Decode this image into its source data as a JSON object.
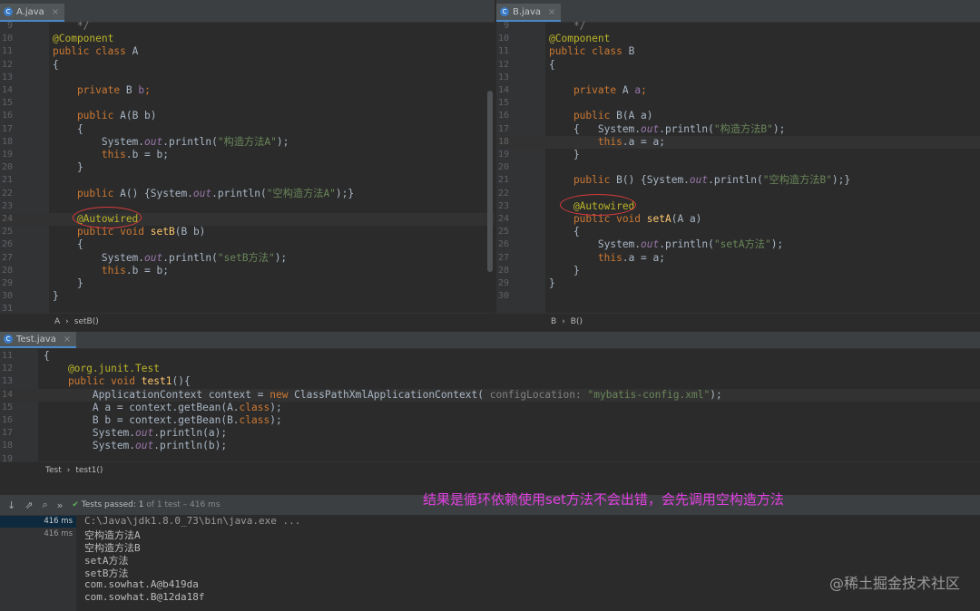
{
  "tabs": {
    "a": "A.java",
    "b": "B.java",
    "test": "Test.java"
  },
  "editor_a": {
    "lines": [
      {
        "n": "9",
        "tokens": [
          {
            "t": "    */",
            "c": "cm"
          }
        ]
      },
      {
        "n": "10",
        "tokens": [
          {
            "t": "@Component",
            "c": "an"
          }
        ]
      },
      {
        "n": "11",
        "tokens": [
          {
            "t": "public class ",
            "c": "kw"
          },
          {
            "t": "A",
            "c": ""
          }
        ]
      },
      {
        "n": "12",
        "tokens": [
          {
            "t": "{",
            "c": ""
          }
        ]
      },
      {
        "n": "13",
        "tokens": []
      },
      {
        "n": "14",
        "tokens": [
          {
            "t": "    private ",
            "c": "kw"
          },
          {
            "t": "B ",
            "c": ""
          },
          {
            "t": "b",
            "c": "hl"
          },
          {
            "t": ";",
            "c": "kw"
          }
        ]
      },
      {
        "n": "15",
        "tokens": []
      },
      {
        "n": "16",
        "tokens": [
          {
            "t": "    public ",
            "c": "kw"
          },
          {
            "t": "A(B b)",
            "c": ""
          }
        ]
      },
      {
        "n": "17",
        "tokens": [
          {
            "t": "    {",
            "c": ""
          }
        ]
      },
      {
        "n": "18",
        "tokens": [
          {
            "t": "        System.",
            "c": ""
          },
          {
            "t": "out",
            "c": "fd"
          },
          {
            "t": ".println(",
            "c": ""
          },
          {
            "t": "\"构造方法A\"",
            "c": "st"
          },
          {
            "t": ");",
            "c": ""
          }
        ]
      },
      {
        "n": "19",
        "tokens": [
          {
            "t": "        this",
            "c": "kw"
          },
          {
            "t": ".b = b;",
            "c": ""
          }
        ]
      },
      {
        "n": "20",
        "tokens": [
          {
            "t": "    }",
            "c": ""
          }
        ]
      },
      {
        "n": "21",
        "tokens": []
      },
      {
        "n": "22",
        "tokens": [
          {
            "t": "    public ",
            "c": "kw"
          },
          {
            "t": "A() {System.",
            "c": ""
          },
          {
            "t": "out",
            "c": "fd"
          },
          {
            "t": ".println(",
            "c": ""
          },
          {
            "t": "\"空构造方法A\"",
            "c": "st"
          },
          {
            "t": ");}",
            "c": ""
          }
        ]
      },
      {
        "n": "23",
        "tokens": []
      },
      {
        "n": "24",
        "tokens": [
          {
            "t": "    @Autowired",
            "c": "an"
          }
        ]
      },
      {
        "n": "25",
        "tokens": [
          {
            "t": "    public void ",
            "c": "kw"
          },
          {
            "t": "setB",
            "c": "fn"
          },
          {
            "t": "(B b)",
            "c": ""
          }
        ]
      },
      {
        "n": "26",
        "tokens": [
          {
            "t": "    {",
            "c": ""
          }
        ]
      },
      {
        "n": "27",
        "tokens": [
          {
            "t": "        System.",
            "c": ""
          },
          {
            "t": "out",
            "c": "fd"
          },
          {
            "t": ".println(",
            "c": ""
          },
          {
            "t": "\"setB方法\"",
            "c": "st"
          },
          {
            "t": ");",
            "c": ""
          }
        ]
      },
      {
        "n": "28",
        "tokens": [
          {
            "t": "        this",
            "c": "kw"
          },
          {
            "t": ".b = b;",
            "c": ""
          }
        ]
      },
      {
        "n": "29",
        "tokens": [
          {
            "t": "    }",
            "c": ""
          }
        ]
      },
      {
        "n": "30",
        "tokens": [
          {
            "t": "}",
            "c": ""
          }
        ]
      },
      {
        "n": "31",
        "tokens": []
      }
    ],
    "breadcrumb": [
      "A",
      "setB()"
    ]
  },
  "editor_b": {
    "lines": [
      {
        "n": "9",
        "tokens": [
          {
            "t": "    */",
            "c": "cm"
          }
        ]
      },
      {
        "n": "10",
        "tokens": [
          {
            "t": "@Component",
            "c": "an"
          }
        ]
      },
      {
        "n": "11",
        "tokens": [
          {
            "t": "public class ",
            "c": "kw"
          },
          {
            "t": "B",
            "c": ""
          }
        ]
      },
      {
        "n": "12",
        "tokens": [
          {
            "t": "{",
            "c": ""
          }
        ]
      },
      {
        "n": "13",
        "tokens": []
      },
      {
        "n": "14",
        "tokens": [
          {
            "t": "    private ",
            "c": "kw"
          },
          {
            "t": "A ",
            "c": ""
          },
          {
            "t": "a",
            "c": "hl"
          },
          {
            "t": ";",
            "c": "kw"
          }
        ]
      },
      {
        "n": "15",
        "tokens": []
      },
      {
        "n": "16",
        "tokens": [
          {
            "t": "    public ",
            "c": "kw"
          },
          {
            "t": "B(A a)",
            "c": ""
          }
        ]
      },
      {
        "n": "17",
        "tokens": [
          {
            "t": "    {   System.",
            "c": ""
          },
          {
            "t": "out",
            "c": "fd"
          },
          {
            "t": ".println(",
            "c": ""
          },
          {
            "t": "\"构造方法B\"",
            "c": "st"
          },
          {
            "t": ");",
            "c": ""
          }
        ]
      },
      {
        "n": "18",
        "tokens": [
          {
            "t": "        this",
            "c": "kw"
          },
          {
            "t": ".a = a;",
            "c": ""
          }
        ]
      },
      {
        "n": "19",
        "tokens": [
          {
            "t": "    }",
            "c": ""
          }
        ]
      },
      {
        "n": "20",
        "tokens": []
      },
      {
        "n": "21",
        "tokens": [
          {
            "t": "    public ",
            "c": "kw"
          },
          {
            "t": "B() {System.",
            "c": ""
          },
          {
            "t": "out",
            "c": "fd"
          },
          {
            "t": ".println(",
            "c": ""
          },
          {
            "t": "\"空构造方法B\"",
            "c": "st"
          },
          {
            "t": ");}",
            "c": ""
          }
        ]
      },
      {
        "n": "22",
        "tokens": []
      },
      {
        "n": "23",
        "tokens": [
          {
            "t": "    @Autowired",
            "c": "an"
          }
        ]
      },
      {
        "n": "24",
        "tokens": [
          {
            "t": "    public void ",
            "c": "kw"
          },
          {
            "t": "setA",
            "c": "fn"
          },
          {
            "t": "(A a)",
            "c": ""
          }
        ]
      },
      {
        "n": "25",
        "tokens": [
          {
            "t": "    {",
            "c": ""
          }
        ]
      },
      {
        "n": "26",
        "tokens": [
          {
            "t": "        System.",
            "c": ""
          },
          {
            "t": "out",
            "c": "fd"
          },
          {
            "t": ".println(",
            "c": ""
          },
          {
            "t": "\"setA方法\"",
            "c": "st"
          },
          {
            "t": ");",
            "c": ""
          }
        ]
      },
      {
        "n": "27",
        "tokens": [
          {
            "t": "        this",
            "c": "kw"
          },
          {
            "t": ".a = a;",
            "c": ""
          }
        ]
      },
      {
        "n": "28",
        "tokens": [
          {
            "t": "    }",
            "c": ""
          }
        ]
      },
      {
        "n": "29",
        "tokens": [
          {
            "t": "}",
            "c": ""
          }
        ]
      },
      {
        "n": "30",
        "tokens": []
      }
    ],
    "breadcrumb": [
      "B",
      "B()"
    ]
  },
  "editor_test": {
    "lines": [
      {
        "n": "11",
        "tokens": [
          {
            "t": "{",
            "c": ""
          }
        ]
      },
      {
        "n": "12",
        "tokens": [
          {
            "t": "    @org.junit.Test",
            "c": "an"
          }
        ]
      },
      {
        "n": "13",
        "tokens": [
          {
            "t": "    public void ",
            "c": "kw"
          },
          {
            "t": "test1",
            "c": "fn"
          },
          {
            "t": "(){",
            "c": ""
          }
        ]
      },
      {
        "n": "14",
        "tokens": [
          {
            "t": "        ApplicationContext context = ",
            "c": ""
          },
          {
            "t": "new ",
            "c": "kw"
          },
          {
            "t": "ClassPathXmlApplicationContext(",
            "c": ""
          },
          {
            "t": " configLocation: ",
            "c": "param"
          },
          {
            "t": "\"mybatis-config.xml\"",
            "c": "st"
          },
          {
            "t": ");",
            "c": ""
          }
        ]
      },
      {
        "n": "15",
        "tokens": [
          {
            "t": "        A a = context.getBean(A.",
            "c": ""
          },
          {
            "t": "class",
            "c": "kw"
          },
          {
            "t": ");",
            "c": ""
          }
        ]
      },
      {
        "n": "16",
        "tokens": [
          {
            "t": "        B b = context.getBean(B.",
            "c": ""
          },
          {
            "t": "class",
            "c": "kw"
          },
          {
            "t": ");",
            "c": ""
          }
        ]
      },
      {
        "n": "17",
        "tokens": [
          {
            "t": "        System.",
            "c": ""
          },
          {
            "t": "out",
            "c": "fd"
          },
          {
            "t": ".println(a);",
            "c": ""
          }
        ]
      },
      {
        "n": "18",
        "tokens": [
          {
            "t": "        System.",
            "c": ""
          },
          {
            "t": "out",
            "c": "fd"
          },
          {
            "t": ".println(b);",
            "c": ""
          }
        ]
      },
      {
        "n": "19",
        "tokens": []
      }
    ],
    "breadcrumb": [
      "Test",
      "test1()"
    ]
  },
  "run": {
    "status_pass": "Tests passed: 1",
    "status_rest": "of 1 test – 416 ms",
    "times": [
      "416 ms",
      "416 ms"
    ],
    "output": [
      "C:\\Java\\jdk1.8.0_73\\bin\\java.exe ...",
      "空构造方法A",
      "空构造方法B",
      "setA方法",
      "setB方法",
      "com.sowhat.A@b419da",
      "com.sowhat.B@12da18f"
    ]
  },
  "annotation": "结果是循环依赖使用set方法不会出错，会先调用空构造方法",
  "watermark": "@稀土掘金技术社区"
}
